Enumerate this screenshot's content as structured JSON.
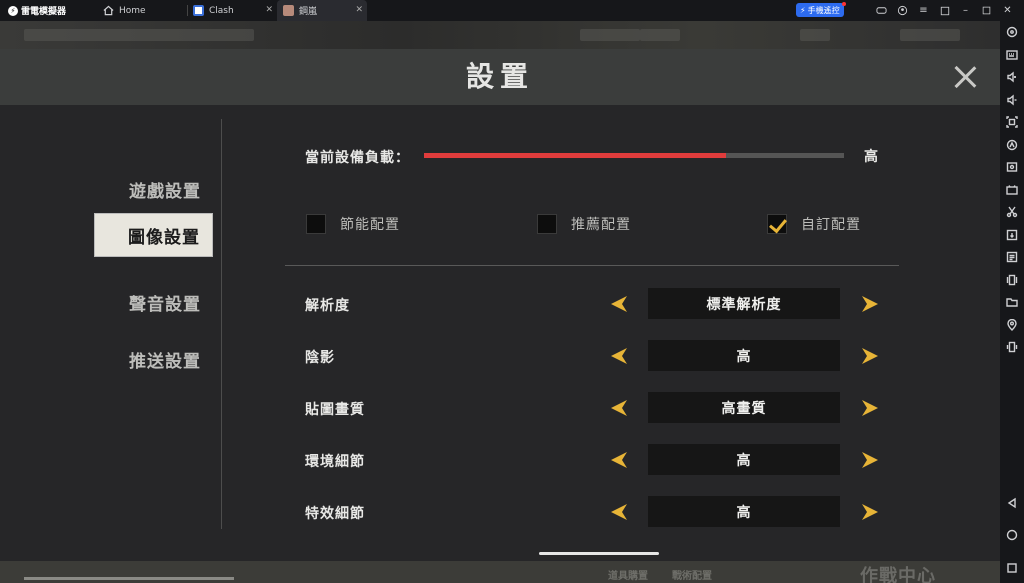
{
  "titlebar": {
    "app_name": "雷電模擬器",
    "tabs": [
      {
        "label": "Home"
      },
      {
        "label": "Clash"
      },
      {
        "label": "鋼嵐"
      }
    ],
    "remote_label": "手機遙控",
    "close_glyph": "✕"
  },
  "background": {
    "bottom_text_1": "道具購置",
    "bottom_text_2": "戰術配置",
    "bottom_text_3": "作戰中心"
  },
  "dialog": {
    "title": "設置",
    "nav": [
      {
        "label": "遊戲設置",
        "active": false
      },
      {
        "label": "圖像設置",
        "active": true
      },
      {
        "label": "聲音設置",
        "active": false
      },
      {
        "label": "推送設置",
        "active": false
      }
    ],
    "load": {
      "label": "當前設備負載：",
      "value_label": "高",
      "level": 0.72
    },
    "presets": [
      {
        "label": "節能配置",
        "checked": false
      },
      {
        "label": "推薦配置",
        "checked": false
      },
      {
        "label": "自訂配置",
        "checked": true
      }
    ],
    "settings": [
      {
        "label": "解析度",
        "value": "標準解析度"
      },
      {
        "label": "陰影",
        "value": "高"
      },
      {
        "label": "貼圖畫質",
        "value": "高畫質"
      },
      {
        "label": "環境細節",
        "value": "高"
      },
      {
        "label": "特效細節",
        "value": "高"
      }
    ]
  },
  "colors": {
    "accent": "#e7b437",
    "load_fill": "#e03c3c",
    "remote_button": "#2d6bef"
  },
  "sidebar_icons": [
    "settings-dot-icon",
    "keyboard-icon",
    "volume-up-icon",
    "volume-down-icon",
    "screenshot-icon",
    "auto-icon",
    "record-icon",
    "apk-icon",
    "scissors-icon",
    "sync-icon",
    "script-icon",
    "shake-icon",
    "folder-icon",
    "location-icon",
    "rotate-icon"
  ]
}
